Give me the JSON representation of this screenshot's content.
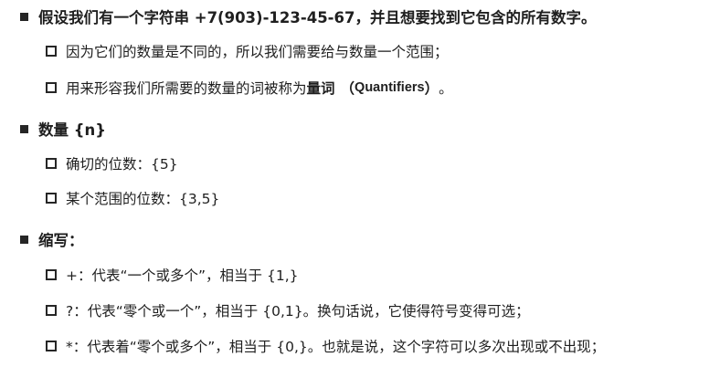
{
  "sections": [
    {
      "heading": "假设我们有一个字符串 +7(903)-123-45-67，并且想要找到它包含的所有数字。",
      "items": [
        {
          "text": "因为它们的数量是不同的，所以我们需要给与数量一个范围；"
        },
        {
          "text_before": "用来形容我们所需要的数量的词被称为",
          "term": "量词",
          "paren_open": "（",
          "term_en": "Quantifiers",
          "paren_close": "）",
          "text_after": "。"
        }
      ]
    },
    {
      "heading": "数量 {n}",
      "items": [
        {
          "text": "确切的位数：{5}"
        },
        {
          "text": "某个范围的位数：{3,5}"
        }
      ]
    },
    {
      "heading": "缩写：",
      "items": [
        {
          "text": "+：代表“一个或多个”，相当于 {1,}"
        },
        {
          "text": "?：代表“零个或一个”，相当于 {0,1}。换句话说，它使得符号变得可选；"
        },
        {
          "text": "*：代表着“零个或多个”，相当于 {0,}。也就是说，这个字符可以多次出现或不出现；"
        }
      ]
    }
  ]
}
